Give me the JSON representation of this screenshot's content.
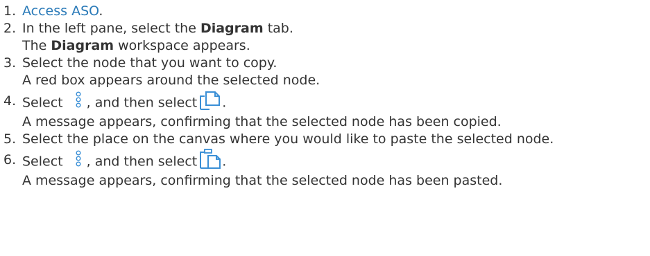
{
  "steps": [
    {
      "number": "1.",
      "link_text": "Access ASO",
      "after_link": "."
    },
    {
      "number": "2.",
      "pre": "In the left pane, select the ",
      "bold": "Diagram",
      "post": " tab.",
      "result_bold": "Diagram",
      "result_post": " workspace appears.",
      "result_pre": "The "
    },
    {
      "number": "3.",
      "text": "Select the node that you want to copy.",
      "result": "A red box appears around the selected node."
    },
    {
      "number": "4.",
      "pre": "Select ",
      "mid": ", and then select",
      "post": ".",
      "icon_a": "more-vertical-icon",
      "icon_b": "copy-icon",
      "result": "A message appears, confirming that the selected node has been copied."
    },
    {
      "number": "5.",
      "text": "Select the place on the canvas where you would like to paste the selected node."
    },
    {
      "number": "6.",
      "pre": "Select ",
      "mid": ", and then select",
      "post": ".",
      "icon_a": "more-vertical-icon",
      "icon_b": "paste-icon",
      "result": "A message appears, confirming that the selected node has been pasted."
    }
  ],
  "colors": {
    "text": "#333333",
    "link": "#2a7ab8",
    "icon": "#3a8fd6"
  }
}
